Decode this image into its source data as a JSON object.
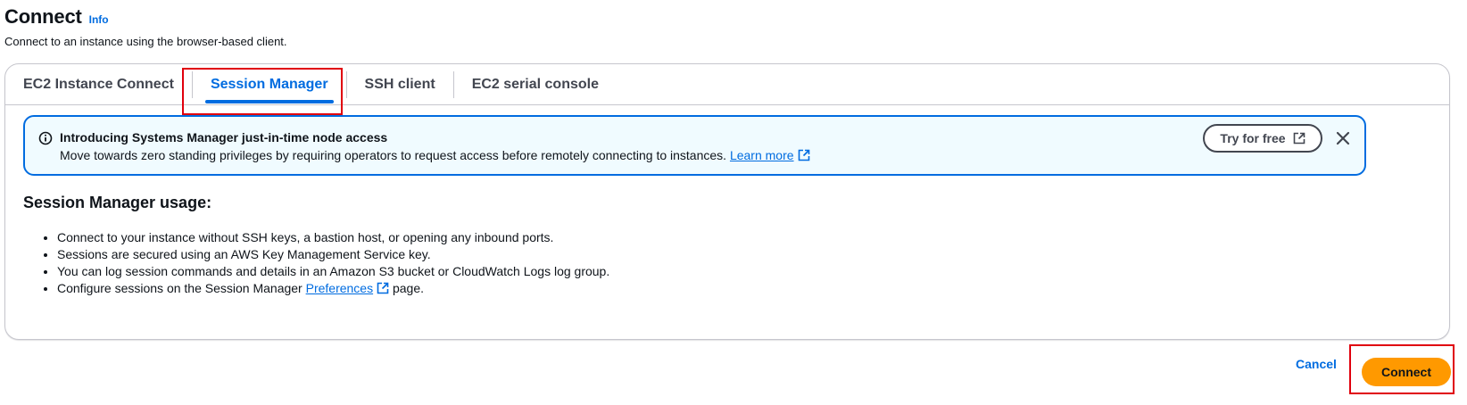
{
  "header": {
    "title": "Connect",
    "info_label": "Info",
    "subtitle": "Connect to an instance using the browser-based client."
  },
  "tabs": [
    {
      "label": "EC2 Instance Connect",
      "selected": false
    },
    {
      "label": "Session Manager",
      "selected": true
    },
    {
      "label": "SSH client",
      "selected": false
    },
    {
      "label": "EC2 serial console",
      "selected": false
    }
  ],
  "flash": {
    "title": "Introducing Systems Manager just-in-time node access",
    "body": "Move towards zero standing privileges by requiring operators to request access before remotely connecting to instances.",
    "learn_more": "Learn more",
    "try_button": "Try for free",
    "icon": "info-circle-icon"
  },
  "usage": {
    "title": "Session Manager usage:",
    "items": [
      "Connect to your instance without SSH keys, a bastion host, or opening any inbound ports.",
      "Sessions are secured using an AWS Key Management Service key.",
      "You can log session commands and details in an Amazon S3 bucket or CloudWatch Logs log group."
    ],
    "last_item_prefix": "Configure sessions on the Session Manager",
    "last_item_link": "Preferences",
    "last_item_suffix": "page."
  },
  "footer": {
    "cancel": "Cancel",
    "connect": "Connect"
  },
  "colors": {
    "accent": "#006ce0",
    "primary_button": "#ff9900",
    "flash_bg": "#f0fbff",
    "highlight": "#e0000d"
  }
}
